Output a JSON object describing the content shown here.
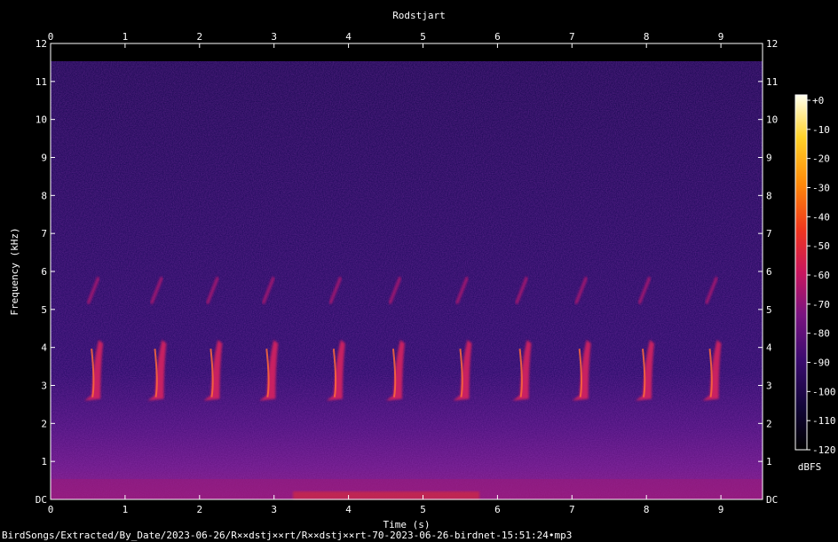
{
  "chart_data": {
    "type": "heatmap",
    "title": "Rodstjart",
    "xlabel": "Time (s)",
    "ylabel": "Frequency (kHz)",
    "xlim": [
      0,
      9.5
    ],
    "ylim": [
      0,
      12
    ],
    "x_ticks": [
      "0",
      "1",
      "2",
      "3",
      "4",
      "5",
      "6",
      "7",
      "8",
      "9"
    ],
    "y_ticks": [
      "DC",
      "1",
      "2",
      "3",
      "4",
      "5",
      "6",
      "7",
      "8",
      "9",
      "10",
      "11",
      "12"
    ],
    "colorbar": {
      "label": "dBFS",
      "range": [
        -120,
        0
      ],
      "ticks": [
        "+0",
        "-10",
        "-20",
        "-30",
        "-40",
        "-50",
        "-60",
        "-70",
        "-80",
        "-90",
        "-100",
        "-110",
        "-120"
      ],
      "colors": [
        "#000000",
        "#120638",
        "#3a0b6e",
        "#7a1480",
        "#c8165e",
        "#f0361e",
        "#ff8a0a",
        "#ffd22a",
        "#ffffee"
      ]
    },
    "song_phrases": [
      {
        "t": 0.55
      },
      {
        "t": 1.4
      },
      {
        "t": 2.15
      },
      {
        "t": 2.9
      },
      {
        "t": 3.8
      },
      {
        "t": 4.6
      },
      {
        "t": 5.5
      },
      {
        "t": 6.3
      },
      {
        "t": 7.1
      },
      {
        "t": 7.95
      },
      {
        "t": 8.85
      }
    ]
  },
  "footer": {
    "file_path": "BirdSongs/Extracted/By_Date/2023-06-26/R××dstj××rt/R××dstj××rt-70-2023-06-26-birdnet-15:51:24•mp3"
  }
}
